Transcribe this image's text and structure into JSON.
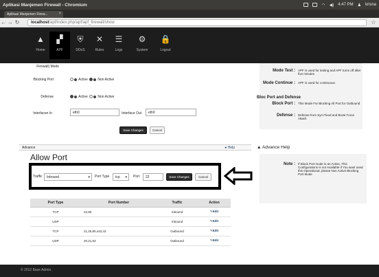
{
  "os_panel": {
    "window_title": "Aplikasi Manjemen Firewall - Chromium",
    "clock": "4:47 PM",
    "user": "krisna"
  },
  "browser": {
    "tab_title": "Aplikasi Manjemen Firew...",
    "url_host": "localhost",
    "url_path": "/apf/index.php/apf/apf_firewall/show"
  },
  "app_nav": [
    {
      "label": "Home",
      "icon": "home-icon",
      "glyph": "▲"
    },
    {
      "label": "APF",
      "icon": "firewall-icon",
      "glyph": "▞"
    },
    {
      "label": "DDoS",
      "icon": "shield-icon",
      "glyph": "⛨"
    },
    {
      "label": "Rules",
      "icon": "tools-icon",
      "glyph": "✕"
    },
    {
      "label": "Logs",
      "icon": "list-icon",
      "glyph": "☰"
    },
    {
      "label": "System",
      "icon": "settings-icon",
      "glyph": "⚙"
    },
    {
      "label": "Logout",
      "icon": "lock-icon",
      "glyph": "🔒"
    }
  ],
  "settings": {
    "mode_label": "Firewall) Mode",
    "blocking_port_label": "Blocking Port",
    "defense_label": "Defense",
    "active": "Active",
    "non_active": "Non Active",
    "interface_in_label": "Interfacen In",
    "interface_in_value": "eth0",
    "interface_out_label": "Interface Out",
    "interface_out_value": "eth0",
    "save_label": "Save Changes",
    "cancel_label": "Cancel"
  },
  "advance": {
    "header": "Advance",
    "help": "Help",
    "title": "Allow Port",
    "traffic_label": "Traffic",
    "traffic_value": "Inbound",
    "port_type_label": "Port Type",
    "port_type_value": "tcp",
    "port_label": "Port",
    "port_value": "22",
    "save_label": "Save Changes",
    "cancel_label": "Cancel"
  },
  "port_table": {
    "headers": [
      "Port Type",
      "Port Number",
      "Traffic",
      "Action"
    ],
    "rows": [
      {
        "type": "TCP",
        "number": "22,80",
        "traffic": "Inbound",
        "action": "Edit"
      },
      {
        "type": "UDP",
        "number": "",
        "traffic": "Inbound",
        "action": "Edit"
      },
      {
        "type": "TCP",
        "number": "21,25,80,443,43",
        "traffic": "Outbound",
        "action": "Edit"
      },
      {
        "type": "UDP",
        "number": "20,21,53",
        "traffic": "Outbound",
        "action": "Edit"
      }
    ]
  },
  "sidebar": {
    "mode_test_key": "Mode Test :",
    "mode_test_val": "APF is used for testing and APF turns off after five minutes",
    "mode_continue_key": "Mode Continue :",
    "mode_continue_val": "APF is used for continuous.",
    "bloc_heading": "Bloc Port and Defense",
    "block_port_key": "Block Port :",
    "block_port_val": "This Mode For Blocking All Port for Outbound",
    "defense_key": "Defense :",
    "defense_val": "Defense from Syn Flood and Brute Force Attack",
    "adv_help_title": "Advance Help",
    "note_key": "Note :",
    "note_val": "If Block Port mode is an Active, This Configurations is not Available If You want used this Operational, please Non Active Blocking Port Mode"
  },
  "footer": "© 2012 Base Admin."
}
